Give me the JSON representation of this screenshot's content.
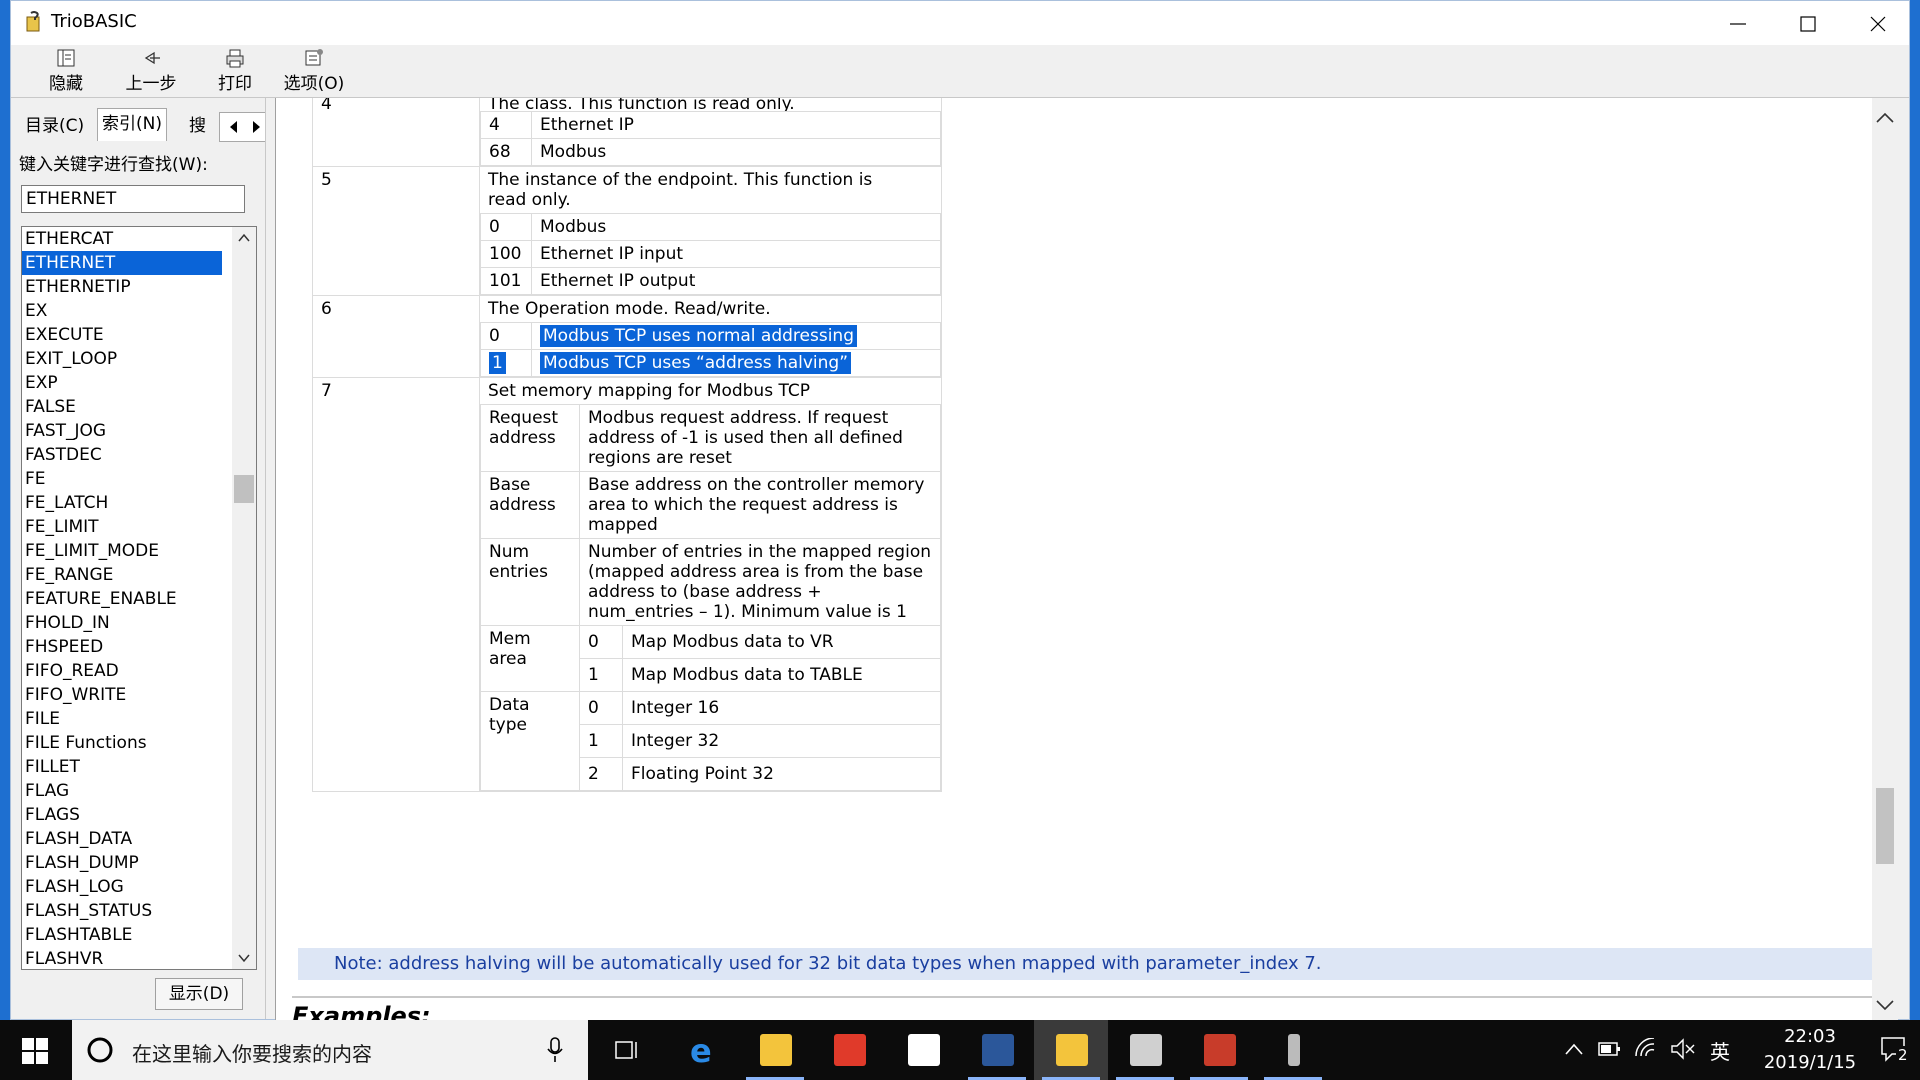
{
  "window": {
    "title": "TrioBASIC"
  },
  "toolbar": {
    "hide": "隐藏",
    "back": "上一步",
    "print": "打印",
    "options": "选项(O)"
  },
  "nav": {
    "tab_contents": "目录(C)",
    "tab_index": "索引(N)",
    "tab_search": "搜",
    "search_label": "键入关键字进行查找(W):",
    "search_value": "ETHERNET",
    "items": [
      "ETHERCAT",
      "ETHERNET",
      "ETHERNETIP",
      "EX",
      "EXECUTE",
      "EXIT_LOOP",
      "EXP",
      "FALSE",
      "FAST_JOG",
      "FASTDEC",
      "FE",
      "FE_LATCH",
      "FE_LIMIT",
      "FE_LIMIT_MODE",
      "FE_RANGE",
      "FEATURE_ENABLE",
      "FHOLD_IN",
      "FHSPEED",
      "FIFO_READ",
      "FIFO_WRITE",
      "FILE",
      "FILE Functions",
      "FILLET",
      "FLAG",
      "FLAGS",
      "FLASH_DATA",
      "FLASH_DUMP",
      "FLASH_LOG",
      "FLASH_STATUS",
      "FLASHTABLE",
      "FLASHVR"
    ],
    "selected": "ETHERNET",
    "display_button": "显示(D)"
  },
  "content": {
    "row4": {
      "index": "4",
      "desc": "The class. This function is read only.",
      "values": [
        [
          "4",
          "Ethernet IP"
        ],
        [
          "68",
          "Modbus"
        ]
      ]
    },
    "row5": {
      "index": "5",
      "desc": "The instance of the endpoint. This function is read only.",
      "values": [
        [
          "0",
          "Modbus"
        ],
        [
          "100",
          "Ethernet IP input"
        ],
        [
          "101",
          "Ethernet IP output"
        ]
      ]
    },
    "row6": {
      "index": "6",
      "desc": "The Operation mode. Read/write.",
      "values": [
        [
          "0",
          "Modbus TCP uses normal addressing"
        ],
        [
          "1",
          "Modbus TCP uses “address halving”"
        ]
      ]
    },
    "row7": {
      "index": "7",
      "desc": "Set memory mapping for Modbus TCP",
      "request_label": "Request address",
      "request_text": "Modbus request address. If request address of -1 is used then all defined regions are reset",
      "base_label": "Base address",
      "base_text": "Base address on the controller memory area to which the request address is mapped",
      "num_label": "Num entries",
      "num_text": "Number of entries in the mapped region (mapped address area is from the base address to (base address + num_entries – 1). Minimum value is 1",
      "mem_label": "Mem area",
      "mem_values": [
        [
          "0",
          "Map Modbus data to VR"
        ],
        [
          "1",
          "Map Modbus data to TABLE"
        ]
      ],
      "type_label": "Data type",
      "type_values": [
        [
          "0",
          "Integer 16"
        ],
        [
          "1",
          "Integer 32"
        ],
        [
          "2",
          "Floating Point 32"
        ]
      ]
    },
    "note": "Note: address halving will be automatically used for 32 bit data types when mapped with parameter_index 7.",
    "examples_heading": "Examples:"
  },
  "taskbar": {
    "search_placeholder": "在这里输入你要搜索的内容",
    "ime": "英",
    "time": "22:03",
    "date": "2019/1/15",
    "notifications": "2"
  }
}
